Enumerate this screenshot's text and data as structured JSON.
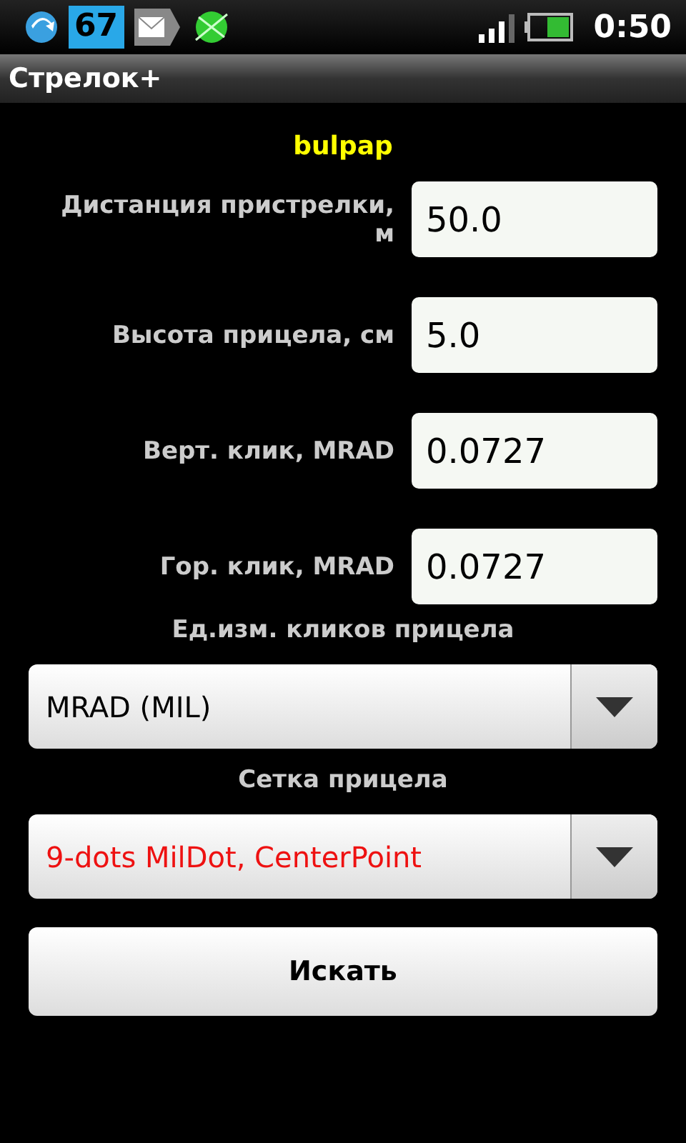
{
  "status_bar": {
    "badge": "67",
    "time": "0:50"
  },
  "window": {
    "title": "Стрелок+"
  },
  "profile": "bulpap",
  "fields": [
    {
      "label": "Дистанция пристрелки, м",
      "value": "50.0"
    },
    {
      "label": "Высота прицела, см",
      "value": "5.0"
    },
    {
      "label": "Верт. клик, MRAD",
      "value": "0.0727"
    },
    {
      "label": "Гор. клик, MRAD",
      "value": "0.0727"
    }
  ],
  "spinners": [
    {
      "label": "Ед.изм. кликов прицела",
      "value": "MRAD (MIL)",
      "color": "#000000"
    },
    {
      "label": "Сетка прицела",
      "value": "9-dots MilDot, CenterPoint",
      "color": "#ee1111"
    }
  ],
  "button": "Искать"
}
